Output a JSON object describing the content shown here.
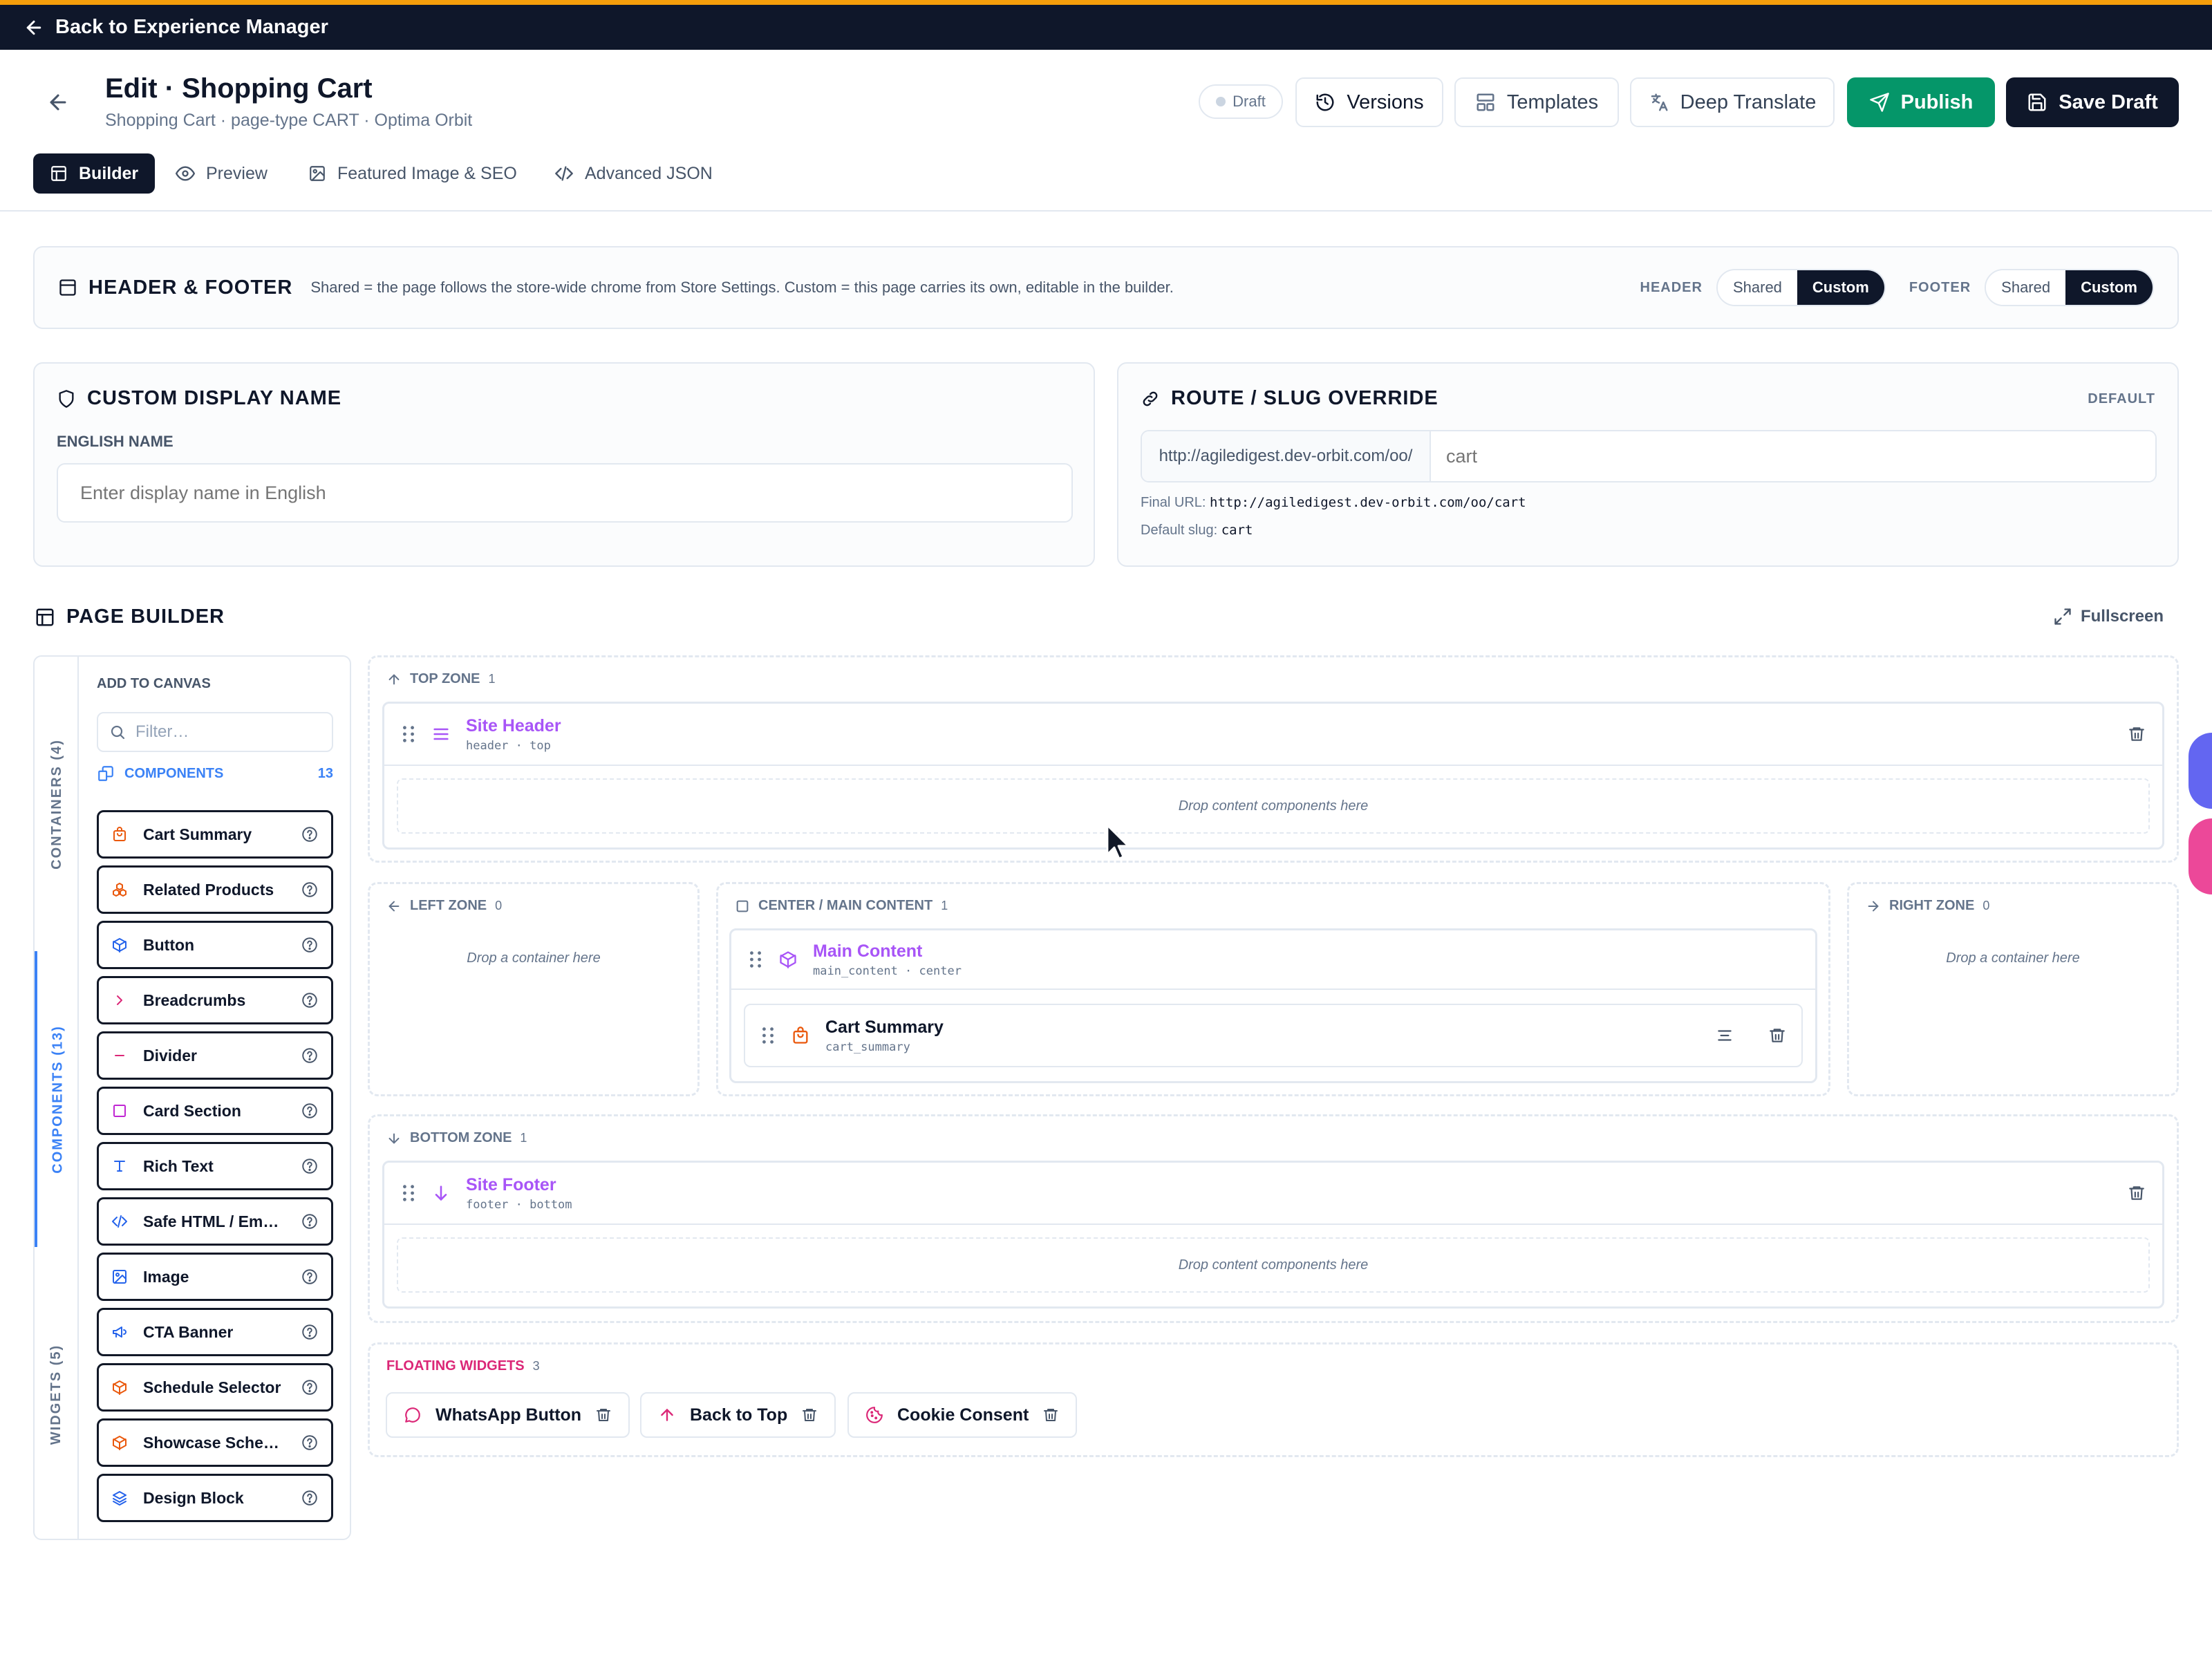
{
  "topbar": {
    "back_label": "Back to Experience Manager"
  },
  "header": {
    "title": "Edit · Shopping Cart",
    "subtitle": "Shopping Cart · page-type CART · Optima Orbit",
    "status": "Draft",
    "buttons": {
      "versions": "Versions",
      "templates": "Templates",
      "deep_translate": "Deep Translate",
      "publish": "Publish",
      "save_draft": "Save Draft"
    }
  },
  "tabs": [
    "Builder",
    "Preview",
    "Featured Image & SEO",
    "Advanced JSON"
  ],
  "header_footer": {
    "title": "HEADER & FOOTER",
    "description": "Shared = the page follows the store-wide chrome from Store Settings. Custom = this page carries its own, editable in the builder.",
    "header_label": "HEADER",
    "footer_label": "FOOTER",
    "shared": "Shared",
    "custom": "Custom",
    "header_selected": "Custom",
    "footer_selected": "Custom"
  },
  "display_name": {
    "title": "CUSTOM DISPLAY NAME",
    "field_label": "ENGLISH NAME",
    "placeholder": "Enter display name in English",
    "value": ""
  },
  "route": {
    "title": "ROUTE / SLUG OVERRIDE",
    "tag": "DEFAULT",
    "prefix": "http://agiledigest.dev-orbit.com/oo/",
    "placeholder": "cart",
    "final_url_label": "Final URL:",
    "final_url": "http://agiledigest.dev-orbit.com/oo/cart",
    "default_slug_label": "Default slug:",
    "default_slug": "cart"
  },
  "page_builder": {
    "title": "PAGE BUILDER",
    "fullscreen": "Fullscreen",
    "sidebar": {
      "vtabs": [
        "CONTAINERS (4)",
        "COMPONENTS (13)",
        "WIDGETS (5)"
      ],
      "add_to_canvas": "ADD TO CANVAS",
      "filter_placeholder": "Filter…",
      "components_label": "COMPONENTS",
      "components_count": "13",
      "components": [
        {
          "name": "Cart Summary",
          "icon": "shopping-bag-icon",
          "color": "#ea580c"
        },
        {
          "name": "Related Products",
          "icon": "cubes-icon",
          "color": "#ea580c"
        },
        {
          "name": "Button",
          "icon": "box-icon",
          "color": "#2563eb"
        },
        {
          "name": "Breadcrumbs",
          "icon": "chevron-right-icon",
          "color": "#db2777"
        },
        {
          "name": "Divider",
          "icon": "minus-icon",
          "color": "#db2777"
        },
        {
          "name": "Card Section",
          "icon": "square-icon",
          "color": "#c026d3"
        },
        {
          "name": "Rich Text",
          "icon": "type-icon",
          "color": "#2563eb"
        },
        {
          "name": "Safe HTML / Em…",
          "icon": "code-icon",
          "color": "#2563eb"
        },
        {
          "name": "Image",
          "icon": "image-icon",
          "color": "#2563eb"
        },
        {
          "name": "CTA Banner",
          "icon": "megaphone-icon",
          "color": "#2563eb"
        },
        {
          "name": "Schedule Selector",
          "icon": "box-icon",
          "color": "#ea580c"
        },
        {
          "name": "Showcase Sche…",
          "icon": "box-icon",
          "color": "#ea580c"
        },
        {
          "name": "Design Block",
          "icon": "layers-icon",
          "color": "#2563eb"
        }
      ]
    },
    "zones": {
      "top": {
        "label": "TOP ZONE",
        "count": "1",
        "container": {
          "title": "Site Header",
          "sub": "header · top"
        },
        "drop": "Drop content components here"
      },
      "left": {
        "label": "LEFT ZONE",
        "count": "0",
        "drop": "Drop a container here"
      },
      "center": {
        "label": "CENTER / MAIN CONTENT",
        "count": "1",
        "container": {
          "title": "Main Content",
          "sub": "main_content · center"
        },
        "item": {
          "title": "Cart Summary",
          "sub": "cart_summary"
        }
      },
      "right": {
        "label": "RIGHT ZONE",
        "count": "0",
        "drop": "Drop a container here"
      },
      "bottom": {
        "label": "BOTTOM ZONE",
        "count": "1",
        "container": {
          "title": "Site Footer",
          "sub": "footer · bottom"
        },
        "drop": "Drop content components here"
      }
    },
    "floating": {
      "label": "FLOATING WIDGETS",
      "count": "3",
      "widgets": [
        "WhatsApp Button",
        "Back to Top",
        "Cookie Consent"
      ]
    }
  },
  "colors": {
    "accent_top": "#f59e0b",
    "dark": "#0f172a",
    "publish": "#059669",
    "container_title": "#a855f7",
    "floating_label": "#db2777"
  }
}
